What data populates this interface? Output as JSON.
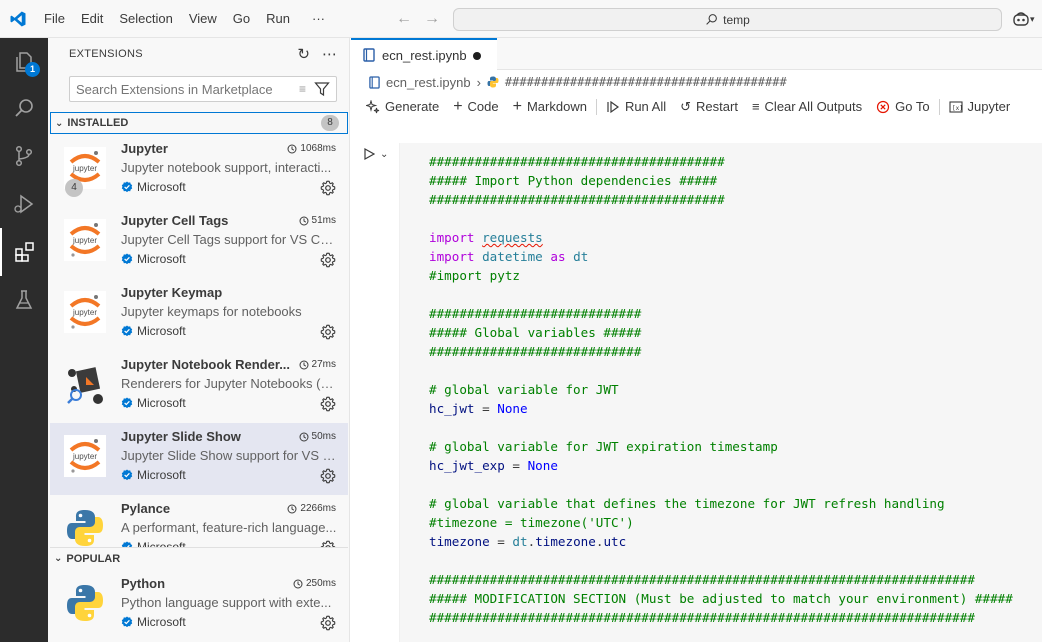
{
  "titlebar": {
    "menu": [
      "File",
      "Edit",
      "Selection",
      "View",
      "Go",
      "Run",
      "···"
    ],
    "search_text": "temp",
    "accent_color": "#0078d4"
  },
  "activity_bar": {
    "items": [
      "explorer-icon",
      "search-icon",
      "source-control-icon",
      "run-debug-icon",
      "extensions-icon",
      "testing-icon"
    ],
    "explorer_badge": "1"
  },
  "sidebar": {
    "title": "EXTENSIONS",
    "search_placeholder": "Search Extensions in Marketplace",
    "installed": {
      "label": "INSTALLED",
      "count": "8",
      "items": [
        {
          "name": "Jupyter",
          "time": "1068ms",
          "desc": "Jupyter notebook support, interacti...",
          "publisher": "Microsoft",
          "icon": "jupyter-icon",
          "badge": "4"
        },
        {
          "name": "Jupyter Cell Tags",
          "time": "51ms",
          "desc": "Jupyter Cell Tags support for VS Code",
          "publisher": "Microsoft",
          "icon": "jupyter-icon"
        },
        {
          "name": "Jupyter Keymap",
          "time": "",
          "desc": "Jupyter keymaps for notebooks",
          "publisher": "Microsoft",
          "icon": "jupyter-icon"
        },
        {
          "name": "Jupyter Notebook Render...",
          "time": "27ms",
          "desc": "Renderers for Jupyter Notebooks (w...",
          "publisher": "Microsoft",
          "icon": "renderers-icon"
        },
        {
          "name": "Jupyter Slide Show",
          "time": "50ms",
          "desc": "Jupyter Slide Show support for VS C...",
          "publisher": "Microsoft",
          "icon": "jupyter-icon",
          "selected": true
        },
        {
          "name": "Pylance",
          "time": "2266ms",
          "desc": "A performant, feature-rich language...",
          "publisher": "Microsoft",
          "icon": "python-icon"
        }
      ]
    },
    "popular": {
      "label": "POPULAR",
      "items": [
        {
          "name": "Python",
          "time": "250ms",
          "desc": "Python language support with exte...",
          "publisher": "Microsoft",
          "icon": "python-icon"
        }
      ]
    }
  },
  "editor": {
    "tab_label": "ecn_rest.ipynb",
    "breadcrumb_file": "ecn_rest.ipynb",
    "breadcrumb_cell": "#######################################",
    "toolbar": [
      "Generate",
      "Code",
      "Markdown",
      "Run All",
      "Restart",
      "Clear All Outputs",
      "Go To",
      "Jupyter"
    ],
    "code_lines": [
      [
        [
          "cm",
          "#######################################"
        ]
      ],
      [
        [
          "cm",
          "##### Import Python dependencies #####"
        ]
      ],
      [
        [
          "cm",
          "#######################################"
        ]
      ],
      [],
      [
        [
          "kw",
          "import"
        ],
        [
          "",
          " "
        ],
        [
          "mod squig",
          "requests"
        ]
      ],
      [
        [
          "kw",
          "import"
        ],
        [
          "",
          " "
        ],
        [
          "mod",
          "datetime"
        ],
        [
          "",
          " "
        ],
        [
          "kw",
          "as"
        ],
        [
          "",
          " "
        ],
        [
          "mod",
          "dt"
        ]
      ],
      [
        [
          "cm",
          "#import pytz"
        ]
      ],
      [],
      [
        [
          "cm",
          "############################"
        ]
      ],
      [
        [
          "cm",
          "##### Global variables #####"
        ]
      ],
      [
        [
          "cm",
          "############################"
        ]
      ],
      [],
      [
        [
          "cm",
          "# global variable for JWT"
        ]
      ],
      [
        [
          "id",
          "hc_jwt"
        ],
        [
          "",
          " = "
        ],
        [
          "cst",
          "None"
        ]
      ],
      [],
      [
        [
          "cm",
          "# global variable for JWT expiration timestamp"
        ]
      ],
      [
        [
          "id",
          "hc_jwt_exp"
        ],
        [
          "",
          " = "
        ],
        [
          "cst",
          "None"
        ]
      ],
      [],
      [
        [
          "cm",
          "# global variable that defines the timezone for JWT refresh handling"
        ]
      ],
      [
        [
          "cm",
          "#timezone = timezone('UTC')"
        ]
      ],
      [
        [
          "id",
          "timezone"
        ],
        [
          "",
          " = "
        ],
        [
          "mod",
          "dt"
        ],
        [
          "",
          "."
        ],
        [
          "id",
          "timezone"
        ],
        [
          "",
          "."
        ],
        [
          "id",
          "utc"
        ]
      ],
      [],
      [
        [
          "cm",
          "########################################################################"
        ]
      ],
      [
        [
          "cm",
          "##### MODIFICATION SECTION (Must be adjusted to match your environment) #####"
        ]
      ],
      [
        [
          "cm",
          "########################################################################"
        ]
      ]
    ]
  }
}
